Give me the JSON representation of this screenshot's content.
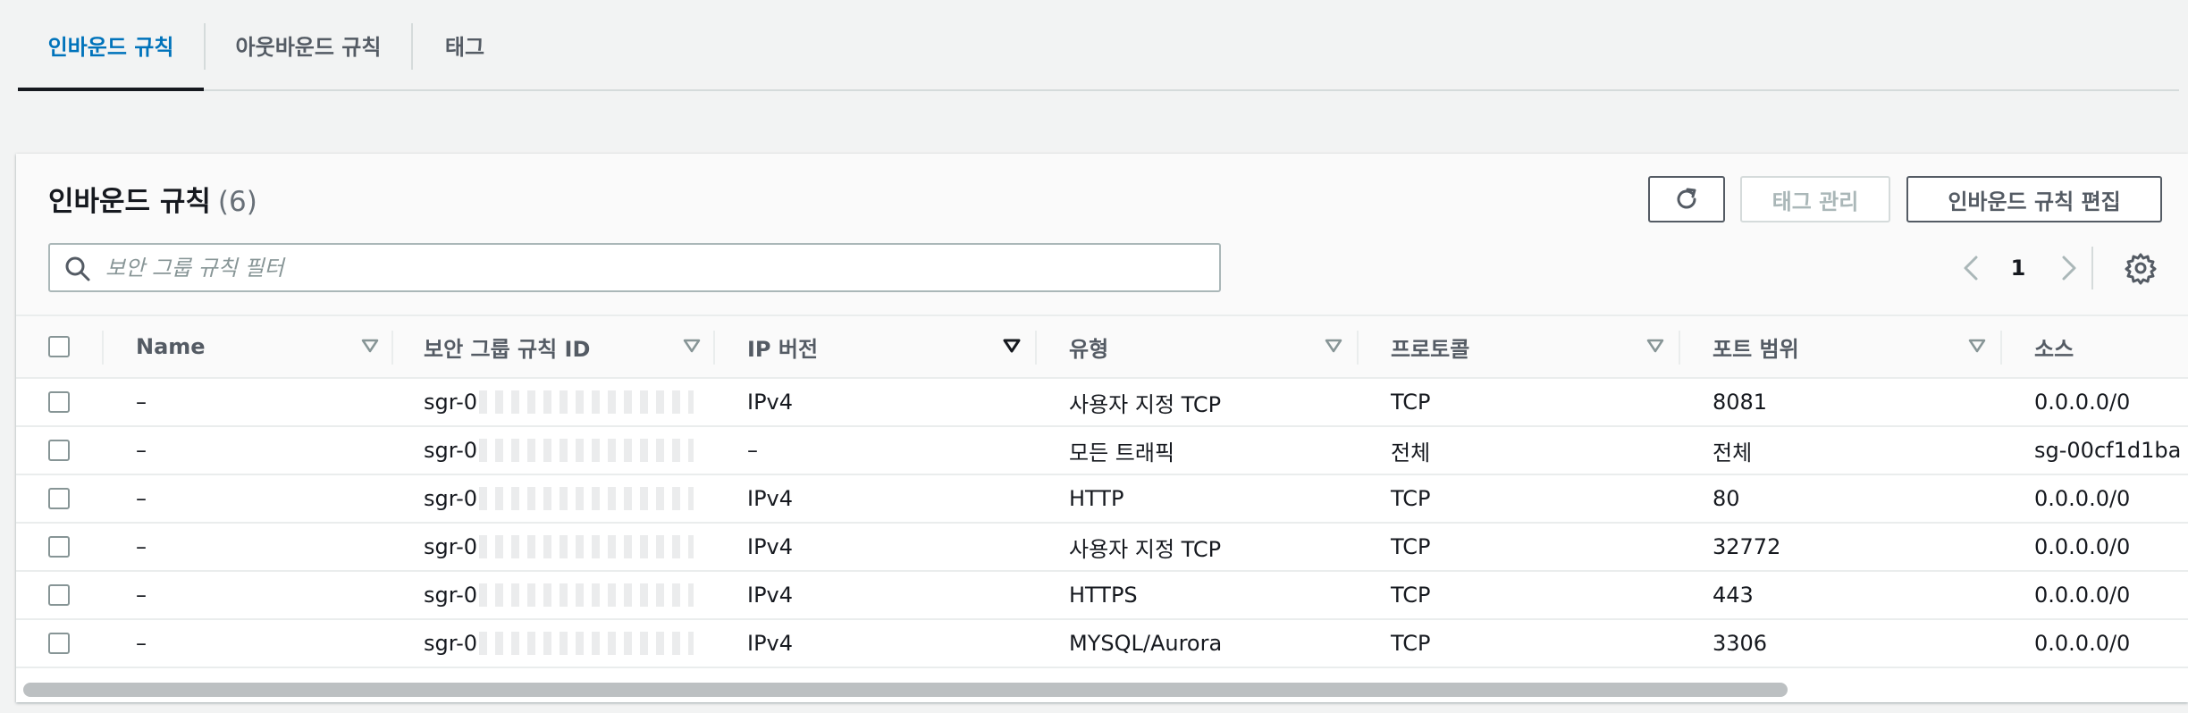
{
  "tabs": [
    "인바운드 규칙",
    "아웃바운드 규칙",
    "태그"
  ],
  "panel": {
    "title": "인바운드 규칙",
    "count": "(6)",
    "buttons": {
      "manage_tags": "태그 관리",
      "edit_rules": "인바운드 규칙 편집"
    },
    "search_placeholder": "보안 그룹 규칙 필터",
    "page": "1"
  },
  "table": {
    "columns": [
      "Name",
      "보안 그룹 규칙 ID",
      "IP 버전",
      "유형",
      "프로토콜",
      "포트 범위",
      "소스"
    ],
    "rows": [
      {
        "name": "–",
        "rule_id": "sgr-0",
        "ip_version": "IPv4",
        "type": "사용자 지정 TCP",
        "protocol": "TCP",
        "port": "8081",
        "source": "0.0.0.0/0"
      },
      {
        "name": "–",
        "rule_id": "sgr-0",
        "ip_version": "–",
        "type": "모든 트래픽",
        "protocol": "전체",
        "port": "전체",
        "source": "sg-00cf1d1ba"
      },
      {
        "name": "–",
        "rule_id": "sgr-0",
        "ip_version": "IPv4",
        "type": "HTTP",
        "protocol": "TCP",
        "port": "80",
        "source": "0.0.0.0/0"
      },
      {
        "name": "–",
        "rule_id": "sgr-0",
        "ip_version": "IPv4",
        "type": "사용자 지정 TCP",
        "protocol": "TCP",
        "port": "32772",
        "source": "0.0.0.0/0"
      },
      {
        "name": "–",
        "rule_id": "sgr-0",
        "ip_version": "IPv4",
        "type": "HTTPS",
        "protocol": "TCP",
        "port": "443",
        "source": "0.0.0.0/0"
      },
      {
        "name": "–",
        "rule_id": "sgr-0",
        "ip_version": "IPv4",
        "type": "MYSQL/Aurora",
        "protocol": "TCP",
        "port": "3306",
        "source": "0.0.0.0/0"
      }
    ]
  },
  "colors": {
    "accent": "#0073bb",
    "text": "#16191f",
    "muted": "#545b64",
    "disabled": "#aab7b8",
    "background": "#f2f3f3"
  },
  "icons": {
    "refresh": "refresh-icon",
    "search": "search-icon",
    "prev": "chevron-left-icon",
    "next": "chevron-right-icon",
    "settings": "gear-icon",
    "sort": "sort-triangle-icon"
  }
}
